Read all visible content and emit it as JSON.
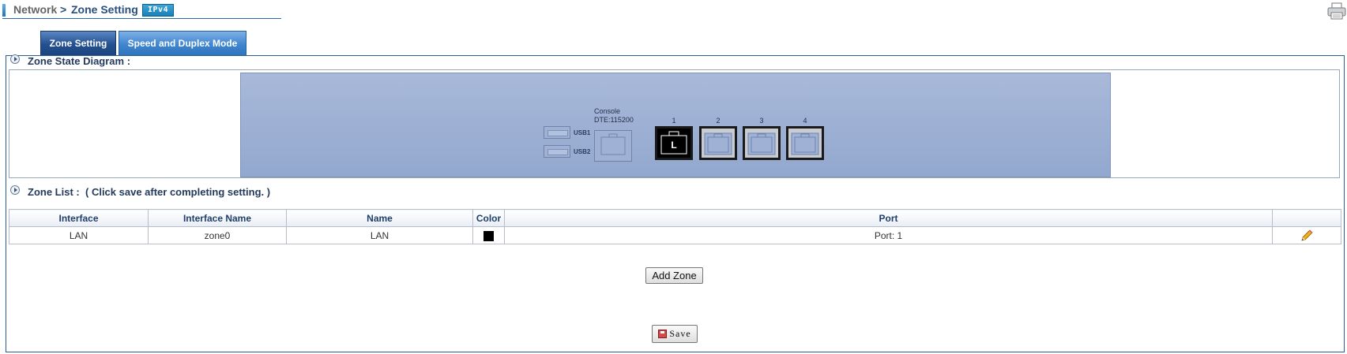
{
  "breadcrumb": {
    "root": "Network",
    "separator": ">",
    "current": "Zone Setting",
    "badge": "IPv4"
  },
  "icons": {
    "printer": "printer-icon",
    "section_arrow": "arrow-circle-icon",
    "edit": "pencil-icon",
    "save": "save-icon"
  },
  "tabs": [
    {
      "label": "Zone Setting",
      "active": true
    },
    {
      "label": "Speed and Duplex Mode",
      "active": false
    }
  ],
  "diagram": {
    "title": "Zone State Diagram :",
    "usb_ports": [
      "USB1",
      "USB2"
    ],
    "console": {
      "label": "Console",
      "sublabel": "DTE:115200"
    },
    "lan_ports": [
      {
        "number": "1",
        "label": "L",
        "active": true
      },
      {
        "number": "2",
        "label": "",
        "active": false
      },
      {
        "number": "3",
        "label": "",
        "active": false
      },
      {
        "number": "4",
        "label": "",
        "active": false
      }
    ]
  },
  "zone_list": {
    "title": "Zone List :",
    "hint": "( Click save after completing setting. )",
    "columns": [
      "Interface",
      "Interface Name",
      "Name",
      "Color",
      "Port",
      ""
    ],
    "rows": [
      {
        "interface": "LAN",
        "interface_name": "zone0",
        "name": "LAN",
        "color": "#000000",
        "port": "Port: 1"
      }
    ]
  },
  "buttons": {
    "add_zone": "Add Zone",
    "save": "Save"
  },
  "colors": {
    "accent": "#24508f",
    "tab_inactive": "#3f86d0",
    "device_panel": "#9fb2d6"
  }
}
